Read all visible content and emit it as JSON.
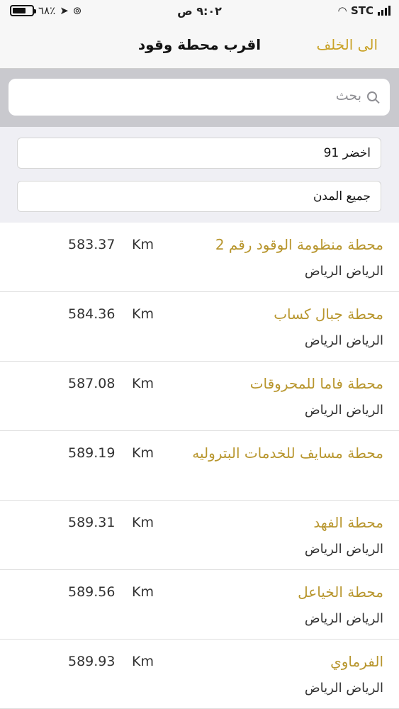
{
  "status_bar": {
    "battery_text": "٦٨٪",
    "time": "٩:٠٢ ص",
    "carrier": "STC"
  },
  "nav": {
    "title": "اقرب محطة وقود",
    "back_label": "الى الخلف"
  },
  "search": {
    "placeholder": "بحث"
  },
  "filters": {
    "fuel_type": "اخضر 91",
    "city": "جميع المدن"
  },
  "accent_color": "#b8962e",
  "stations": [
    {
      "name": "محطة منظومة الوقود رقم 2",
      "city": "الرياض الرياض",
      "distance": "583.37",
      "unit": "Km"
    },
    {
      "name": "محطة جبال كساب",
      "city": "الرياض الرياض",
      "distance": "584.36",
      "unit": "Km"
    },
    {
      "name": "محطة فاما للمحروقات",
      "city": "الرياض الرياض",
      "distance": "587.08",
      "unit": "Km"
    },
    {
      "name": "محطة مسايف للخدمات البتروليه",
      "city": "",
      "distance": "589.19",
      "unit": "Km"
    },
    {
      "name": "محطة الفهد",
      "city": "الرياض الرياض",
      "distance": "589.31",
      "unit": "Km"
    },
    {
      "name": "محطة الخياعل",
      "city": "الرياض الرياض",
      "distance": "589.56",
      "unit": "Km"
    },
    {
      "name": "الفرماوي",
      "city": "الرياض الرياض",
      "distance": "589.93",
      "unit": "Km"
    }
  ]
}
